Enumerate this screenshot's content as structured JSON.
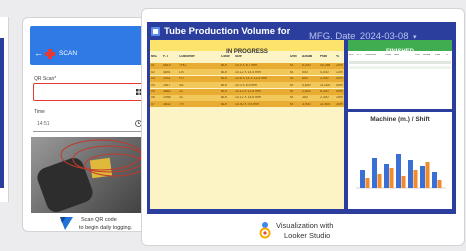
{
  "left_card": {
    "phone_header": {
      "back_glyph": "←",
      "logo": "cross-logo",
      "title": "SCAN"
    },
    "qr_field": {
      "label": "QR Scan*",
      "value": ""
    },
    "time_field": {
      "label": "Time",
      "value": "14:51"
    },
    "caption": {
      "line1": "Scan QR code",
      "line2": "to begin daily logging."
    },
    "colors": {
      "header_bg": "#2f7ae5",
      "field_border": "#e53935"
    }
  },
  "right_card": {
    "dashboard": {
      "title": "Tube Production Volume for",
      "filter_label": "MFG. Date",
      "filter_value": "2024-03-08",
      "in_progress": {
        "header": "IN PROGRESS",
        "columns": [
          "M/C",
          "F-T",
          "Customer",
          "Color",
          "Size",
          "Unit",
          "Actual",
          "Plan",
          "%"
        ],
        "rows": [
          {
            "mc": "01",
            "ft": "4819",
            "customer": "THO",
            "color": "BLK",
            "size": "10.4 X 6.7 mm",
            "unit": "M.",
            "actual": "8,000",
            "plan": "40,268",
            "pct": "20%"
          },
          {
            "mc": "02",
            "ft": "4891",
            "customer": "OX",
            "color": "BLK",
            "size": "10.12 X 14.5 mm",
            "unit": "M.",
            "actual": "500",
            "plan": "4,000",
            "pct": "13%"
          },
          {
            "mc": "03",
            "ft": "1941",
            "customer": "FU",
            "color": "BLK",
            "size": "10.6 X 14 X 13.5 mm",
            "unit": "M.",
            "actual": "800",
            "plan": "2,000",
            "pct": "40%"
          },
          {
            "mc": "04",
            "ft": "1817",
            "customer": "SA",
            "color": "BLK",
            "size": "10.3 X 6.6 mm",
            "unit": "M.",
            "actual": "4,800",
            "plan": "11,000",
            "pct": "44%"
          },
          {
            "mc": "05",
            "ft": "3683",
            "customer": "JO",
            "color": "BLK",
            "size": "10.13 X 11.8 mm",
            "unit": "M.",
            "actual": "2,800",
            "plan": "6,300",
            "pct": "44%"
          },
          {
            "mc": "06",
            "ft": "1998",
            "customer": "JO",
            "color": "BLK",
            "size": "10.12 X 14.6 mm",
            "unit": "M.",
            "actual": "350",
            "plan": "2,300",
            "pct": "15%"
          },
          {
            "mc": "07",
            "ft": "3832",
            "customer": "TH",
            "color": "BLK",
            "size": "10.40 X 9.6 mm",
            "unit": "M.",
            "actual": "3,900",
            "plan": "11,500",
            "pct": "34%"
          }
        ]
      },
      "finished": {
        "header": "FINISHED",
        "columns": [
          "M/C",
          "F-T",
          "Customer",
          "Color",
          "Size",
          "Unit",
          "Actual",
          "Plan",
          "%"
        ]
      },
      "shift_chart": {
        "title": "Machine (m.) / Shift"
      },
      "colors": {
        "bg": "#2b3e9e",
        "in_progress": "#fbe36c",
        "finished": "#3fad50",
        "row_dark": "#e9ac32",
        "row_light": "#f3c85a"
      }
    },
    "caption": {
      "line1": "Visualization with",
      "line2": "Looker Studio"
    }
  }
}
